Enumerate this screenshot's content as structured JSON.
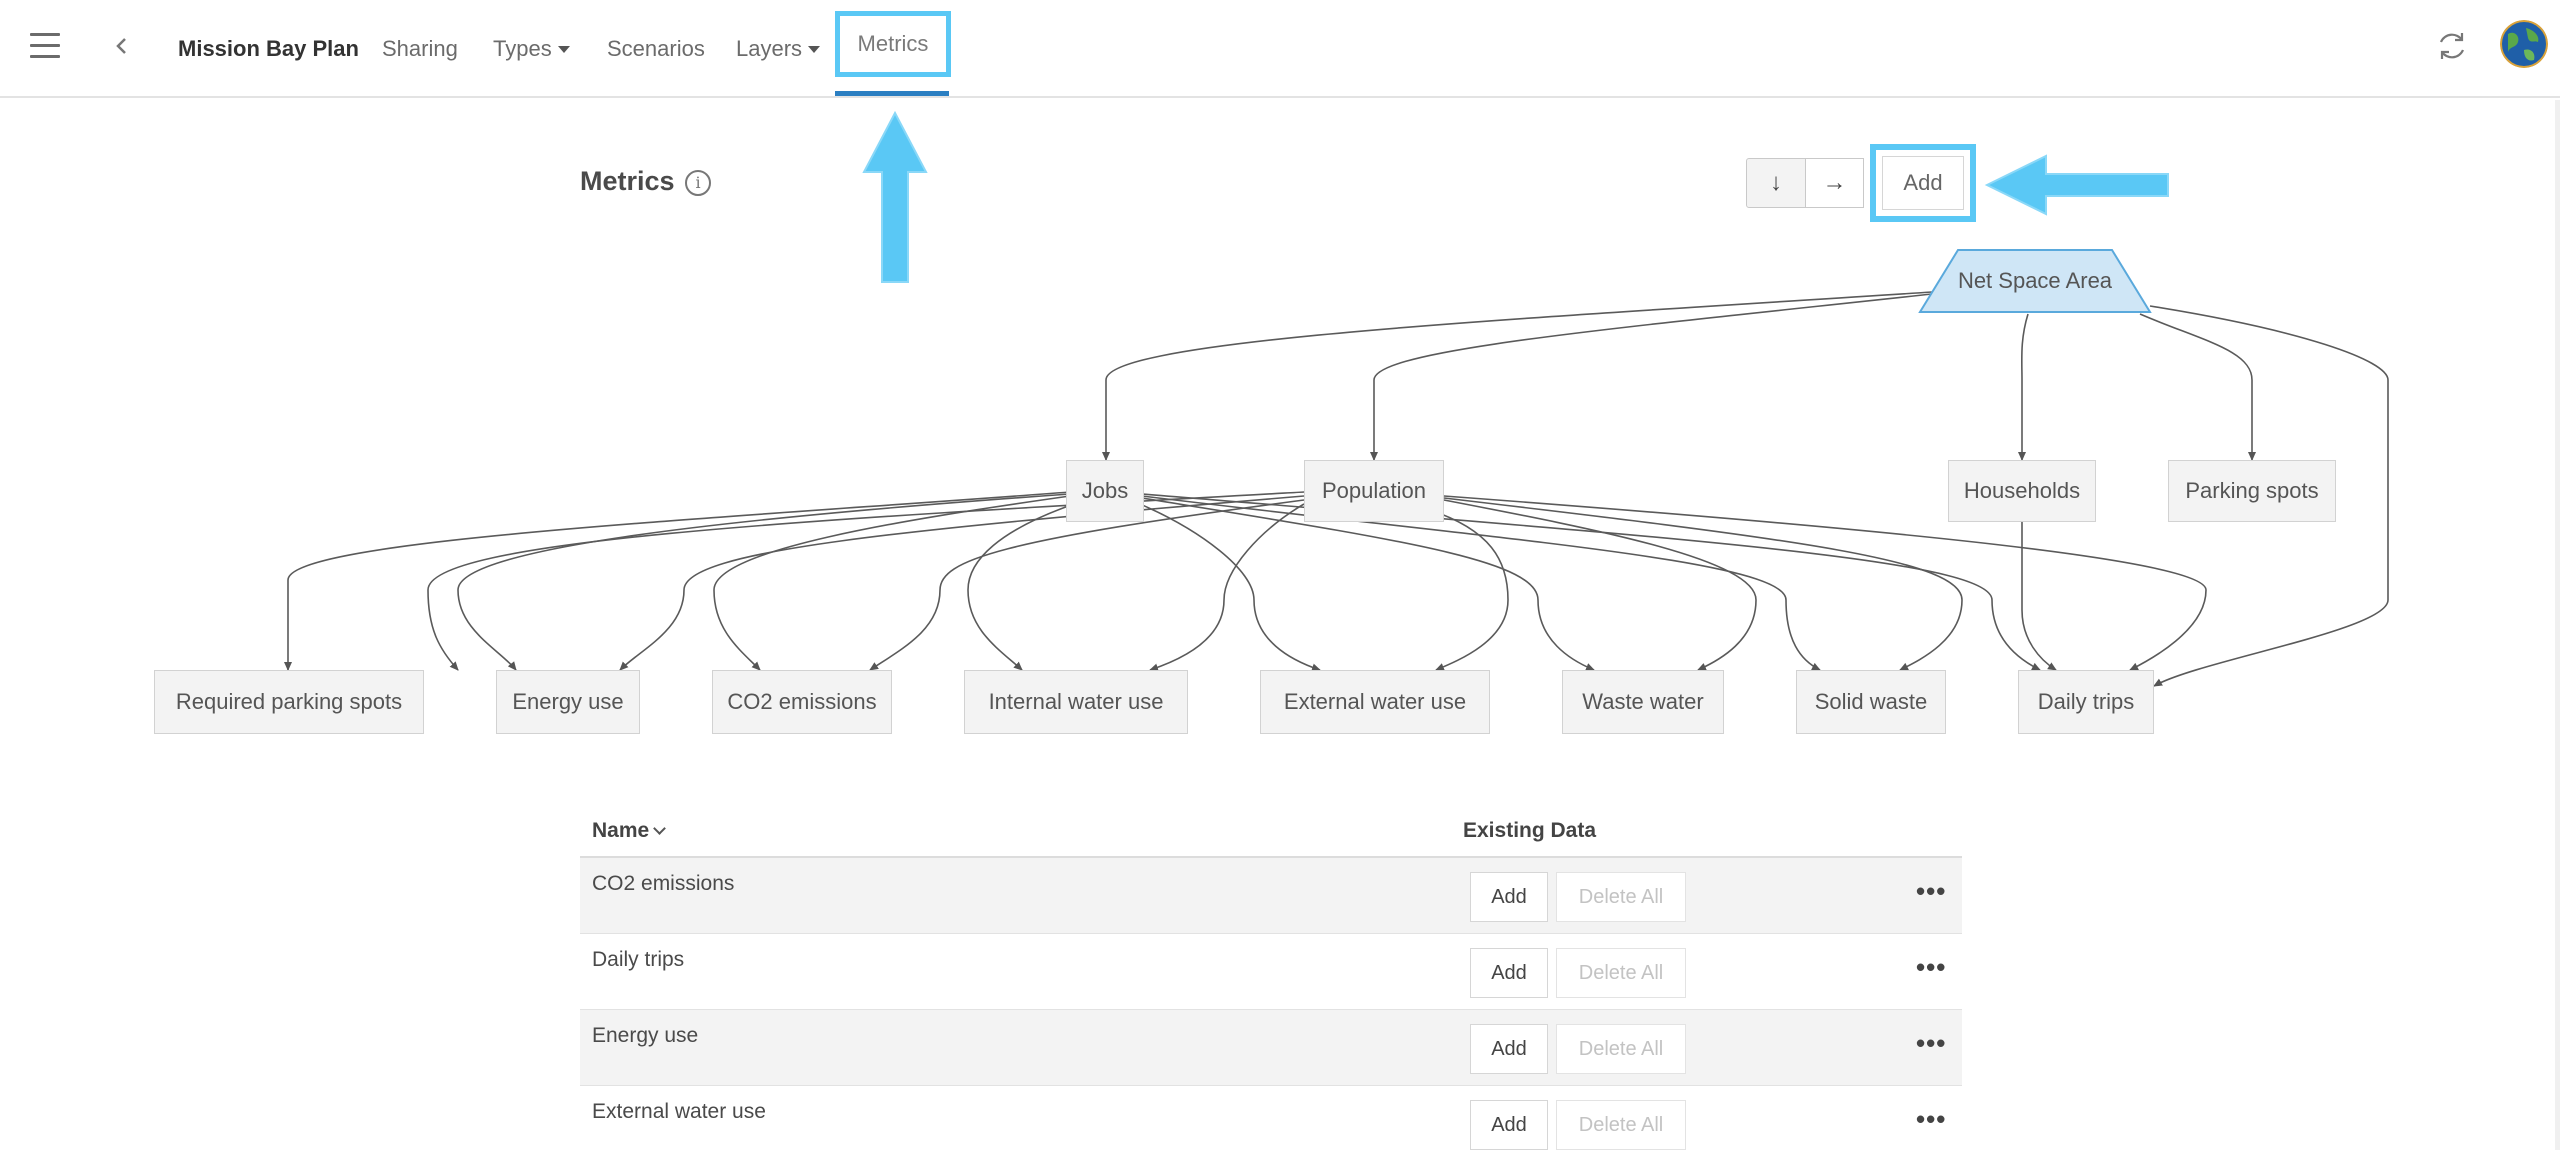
{
  "nav": {
    "project_title": "Mission Bay Plan",
    "tabs": [
      {
        "label": "Sharing"
      },
      {
        "label": "Types"
      },
      {
        "label": "Scenarios"
      },
      {
        "label": "Layers"
      },
      {
        "label": "Metrics"
      }
    ],
    "active_tab": "Metrics",
    "icons": [
      "hamburger-menu-icon",
      "back-chevron-icon",
      "refresh-icon",
      "globe-avatar-icon"
    ]
  },
  "metrics": {
    "title": "Metrics",
    "info_symbol": "i",
    "controls": {
      "down_arrow": "↓",
      "right_arrow": "→",
      "add_label": "Add"
    }
  },
  "diagram": {
    "root": "Net Space Area",
    "middle": [
      "Jobs",
      "Population",
      "Households",
      "Parking spots"
    ],
    "bottom": [
      "Required parking spots",
      "Energy use",
      "CO2 emissions",
      "Internal water use",
      "External water use",
      "Waste water",
      "Solid waste",
      "Daily trips"
    ],
    "edges": [
      [
        "Net Space Area",
        "Jobs"
      ],
      [
        "Net Space Area",
        "Population"
      ],
      [
        "Net Space Area",
        "Households"
      ],
      [
        "Net Space Area",
        "Parking spots"
      ],
      [
        "Net Space Area",
        "Daily trips"
      ],
      [
        "Jobs",
        "Required parking spots"
      ],
      [
        "Jobs",
        "Energy use"
      ],
      [
        "Jobs",
        "CO2 emissions"
      ],
      [
        "Jobs",
        "Internal water use"
      ],
      [
        "Jobs",
        "External water use"
      ],
      [
        "Jobs",
        "Waste water"
      ],
      [
        "Jobs",
        "Solid waste"
      ],
      [
        "Jobs",
        "Daily trips"
      ],
      [
        "Population",
        "Energy use"
      ],
      [
        "Population",
        "CO2 emissions"
      ],
      [
        "Population",
        "Internal water use"
      ],
      [
        "Population",
        "External water use"
      ],
      [
        "Population",
        "Waste water"
      ],
      [
        "Population",
        "Solid waste"
      ],
      [
        "Population",
        "Daily trips"
      ],
      [
        "Households",
        "Daily trips"
      ]
    ]
  },
  "table": {
    "columns": {
      "name": "Name",
      "existing": "Existing Data"
    },
    "rows": [
      {
        "name": "CO2 emissions",
        "add": "Add",
        "delete": "Delete All",
        "more": "•••"
      },
      {
        "name": "Daily trips",
        "add": "Add",
        "delete": "Delete All",
        "more": "•••"
      },
      {
        "name": "Energy use",
        "add": "Add",
        "delete": "Delete All",
        "more": "•••"
      },
      {
        "name": "External water use",
        "add": "Add",
        "delete": "Delete All",
        "more": "•••"
      }
    ]
  },
  "colors": {
    "highlight": "#5ac8f5",
    "active_underline": "#2b7fc2",
    "root_node_fill": "#cfe6f6",
    "root_node_stroke": "#5aa9dc"
  }
}
